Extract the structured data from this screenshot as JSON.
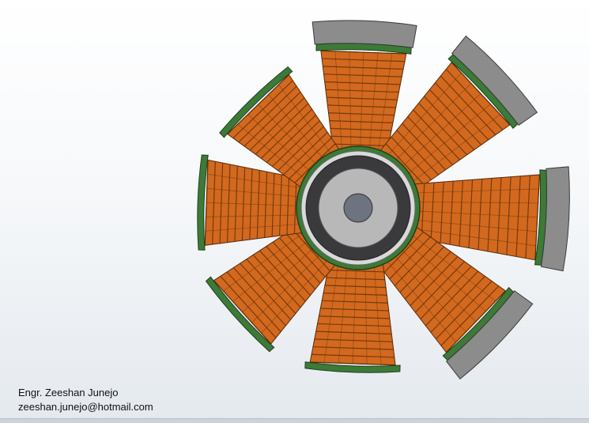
{
  "credits": {
    "name": "Engr. Zeeshan Junejo",
    "email": "zeeshan.junejo@hotmail.com"
  },
  "model": {
    "pole_count": 8,
    "magnet_poles_shown": 4
  },
  "colors": {
    "background_top": "#ffffff",
    "background_bottom": "#e4e9ee",
    "coil_copper": "#d2691e",
    "coil_edge": "#5a2a08",
    "insulation_green": "#3d7a38",
    "magnet_gray": "#8c8c8c",
    "hub_dark": "#3a3a3c",
    "hub_light": "#b8b8b8",
    "shaft": "#6d7480"
  }
}
